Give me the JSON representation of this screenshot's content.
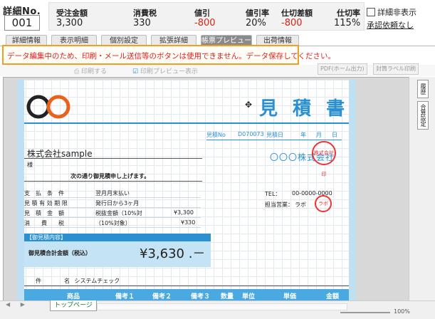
{
  "header": {
    "detail_label": "詳細No.",
    "detail_no": "001",
    "metrics": [
      {
        "label": "受注金額",
        "value": "3,300"
      },
      {
        "label": "消費税",
        "value": "330"
      },
      {
        "label": "値引",
        "value": "-800"
      },
      {
        "label": "値引率",
        "value": "20%"
      },
      {
        "label": "仕切差額",
        "value": "-800"
      },
      {
        "label": "仕切率",
        "value": "115%"
      }
    ],
    "hide_detail_label": "詳細非表示",
    "approval_link": "承認依頼なし"
  },
  "tabs": [
    {
      "label": "詳細情報",
      "active": false
    },
    {
      "label": "表示明細",
      "active": false
    },
    {
      "label": "個別設定",
      "active": false
    },
    {
      "label": "拡張詳細",
      "active": false
    },
    {
      "label": "帳票プレビュー",
      "active": true
    },
    {
      "label": "出荷情報",
      "active": false
    }
  ],
  "warning": "データ編集中のため、印刷・メール送信等のボタンは使用できません。データ保存してください。",
  "toolbar": {
    "print": "印刷する",
    "print_preview": "印刷プレビュー表示",
    "pdf_label": "PDF(ホーム出力)",
    "envelope_label": "封筒ラベル印刷"
  },
  "document": {
    "title": "見 積 書",
    "estimate_no_label": "見積No",
    "estimate_no": "D070073",
    "estimate_date_label": "見積日",
    "date_year": "年",
    "date_month": "月",
    "date_day": "日",
    "customer": "株式会社sample",
    "honorific": "様",
    "issuer": "〇〇〇株式会社",
    "stamp_text": "株式会社印",
    "offer_text": "次の通り御見積申し上げます。",
    "rows": [
      {
        "label": "支　払　条　件",
        "value": "翌月月末払い",
        "amount": ""
      },
      {
        "label": "見 積 有 効 期 限",
        "value": "発行日から3ヶ月",
        "amount": ""
      },
      {
        "label": "見　積　金　額",
        "value": "税抜金額（10%対",
        "amount": "¥3,300"
      },
      {
        "label": "消　　費　　税",
        "value": "（10%対象）",
        "amount": "¥330"
      }
    ],
    "tel_label": "TEL：",
    "tel": "00-0000-0000",
    "staff_label": "担当営業：",
    "staff": "ラボ",
    "content_header": "【御見積内容】",
    "total_label": "御見積合計金額（税込）",
    "total_value": "¥3,630 .－",
    "subject_label": "件　　　　名",
    "subject_value": "システムチェック",
    "table_headers": [
      "商品",
      "備考１",
      "備考２",
      "備考３",
      "数量",
      "単位",
      "単価",
      "金額"
    ]
  },
  "side_buttons": [
    "履歴",
    "合算設定"
  ],
  "bottom": {
    "sheet_tab": "トップページ",
    "zoom": "100%"
  }
}
